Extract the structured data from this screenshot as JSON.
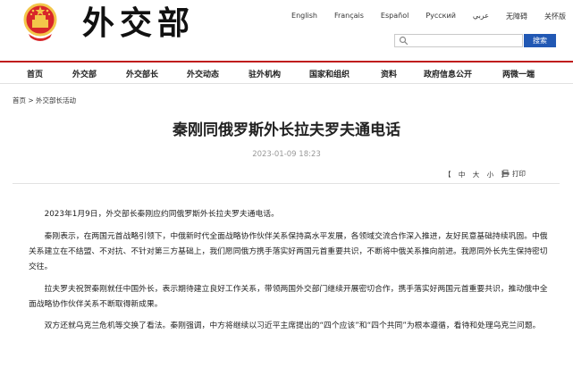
{
  "header": {
    "logo_text": "外交部",
    "languages": [
      "English",
      "Français",
      "Español",
      "Русский",
      "عربي",
      "无障碍",
      "关怀版"
    ],
    "search": {
      "placeholder": "",
      "button_label": "搜索"
    }
  },
  "nav": {
    "items": [
      "首页",
      "外交部",
      "外交部长",
      "外交动态",
      "驻外机构",
      "国家和组织",
      "资料",
      "政府信息公开",
      "两微一端"
    ]
  },
  "breadcrumb": "首页 > 外交部长活动",
  "article": {
    "title": "秦刚同俄罗斯外长拉夫罗夫通电话",
    "date": "2023-01-09 18:23",
    "font_size_bracket_open": "【",
    "font_sizes": [
      "中",
      "大",
      "小"
    ],
    "font_size_bracket_close": "】",
    "print_label": "打印",
    "paragraphs": [
      "2023年1月9日，外交部长秦刚应约同俄罗斯外长拉夫罗夫通电话。",
      "秦刚表示，在两国元首战略引领下，中俄新时代全面战略协作伙伴关系保持高水平发展，各领域交流合作深入推进，友好民意基础持续巩固。中俄关系建立在不结盟、不对抗、不针对第三方基础上，我们愿同俄方携手落实好两国元首重要共识，不断将中俄关系推向前进。我愿同外长先生保持密切交往。",
      "拉夫罗夫祝贺秦刚就任中国外长，表示期待建立良好工作关系，带领两国外交部门继续开展密切合作，携手落实好两国元首重要共识，推动俄中全面战略协作伙伴关系不断取得新成果。",
      "双方还就乌克兰危机等交换了看法。秦刚强调，中方将继续以习近平主席提出的“四个应该”和“四个共同”为根本遵循，看待和处理乌克兰问题。"
    ]
  },
  "colors": {
    "accent_red": "#c01c1c",
    "search_blue": "#2158b4",
    "emblem_red": "#d8262a",
    "emblem_gold": "#f3c64a"
  },
  "icons": [
    "national-emblem-icon",
    "search-icon",
    "print-icon"
  ]
}
